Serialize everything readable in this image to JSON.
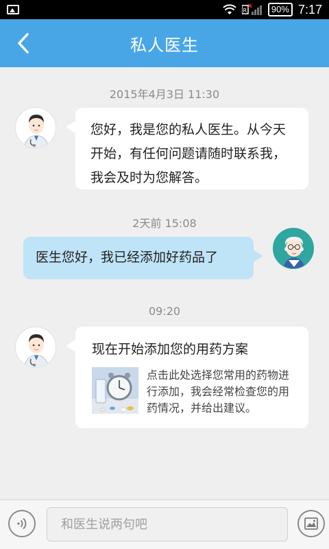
{
  "status_bar": {
    "battery": "90%",
    "time": "7:17"
  },
  "header": {
    "title": "私人医生"
  },
  "messages": {
    "ts1": "2015年4月3日  11:30",
    "msg1": "您好，我是您的私人医生。从今天开始，有任何问题请随时联系我，我会及时为您解答。",
    "ts2": "2天前  15:08",
    "msg2": "医生您好，我已经添加好药品了",
    "ts3": "09:20",
    "card_title": "现在开始添加您的用药方案",
    "card_text": "点击此处选择您常用的药物进行添加，我会经常检查您的用药情况，并给出建议。"
  },
  "input_bar": {
    "placeholder": "和医生说两句吧"
  },
  "colors": {
    "header_bg": "#49a6e6",
    "user_bubble": "#bfe3f7",
    "doctor_bubble": "#ffffff",
    "background": "#efefef"
  },
  "icons": {
    "back": "chevron-left-icon",
    "voice": "voice-icon",
    "image": "image-icon"
  }
}
